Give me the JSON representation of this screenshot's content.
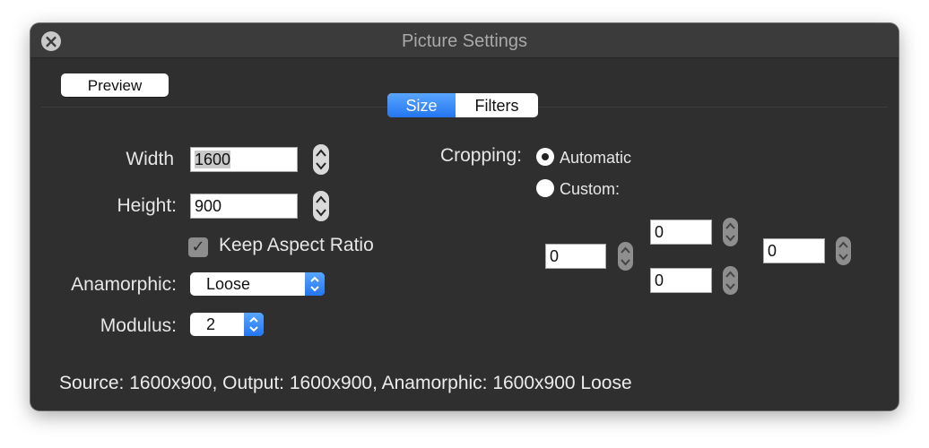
{
  "window": {
    "title": "Picture Settings"
  },
  "toolbar": {
    "preview_label": "Preview"
  },
  "tabs": [
    {
      "label": "Size",
      "selected": true
    },
    {
      "label": "Filters",
      "selected": false
    }
  ],
  "size": {
    "width_label": "Width",
    "width_value": "1600",
    "height_label": "Height:",
    "height_value": "900",
    "keep_aspect_label": "Keep Aspect Ratio",
    "keep_aspect_checked": true,
    "anamorphic_label": "Anamorphic:",
    "anamorphic_value": "Loose",
    "modulus_label": "Modulus:",
    "modulus_value": "2"
  },
  "cropping": {
    "label": "Cropping:",
    "options": [
      {
        "label": "Automatic",
        "selected": true
      },
      {
        "label": "Custom:",
        "selected": false
      }
    ],
    "top": "0",
    "bottom": "0",
    "left": "0",
    "right": "0"
  },
  "status": "Source: 1600x900, Output: 1600x900, Anamorphic: 1600x900 Loose",
  "colors": {
    "accent": "#2f86f7",
    "window_bg": "#2f2f2f"
  }
}
